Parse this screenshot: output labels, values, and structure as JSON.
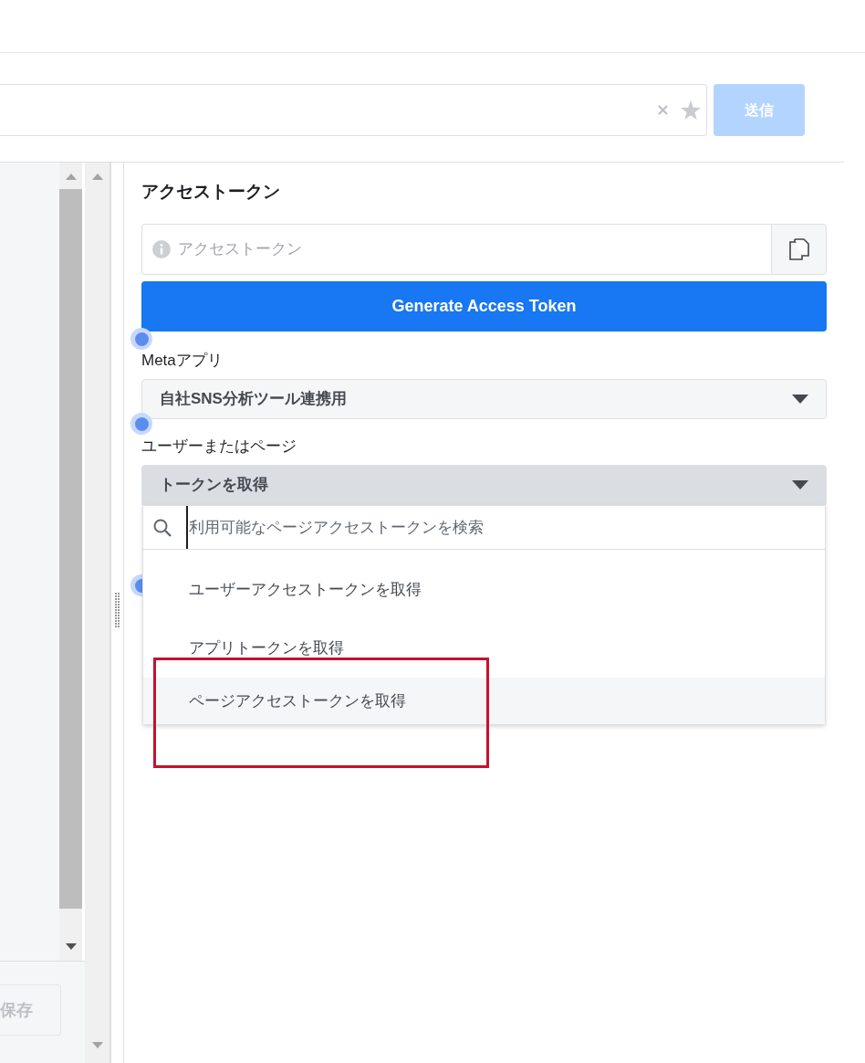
{
  "query_bar": {
    "submit_button": "送信",
    "submit_disabled": true
  },
  "left_panel": {
    "save_button": "保存"
  },
  "access_token": {
    "title": "アクセストークン",
    "field": {
      "placeholder": "アクセストークン"
    },
    "generate_button": "Generate Access Token"
  },
  "meta_app": {
    "label": "Metaアプリ",
    "value": "自社SNS分析ツール連携用"
  },
  "user_or_page": {
    "label": "ユーザーまたはページ",
    "value": "トークンを取得",
    "expanded": true,
    "search": {
      "placeholder": "利用可能なページアクセストークンを検索"
    },
    "options": [
      {
        "label": "ユーザーアクセストークンを取得",
        "selected": false
      },
      {
        "label": "アプリトークンを取得",
        "selected": false
      },
      {
        "label": "ページアクセストークンを取得",
        "selected": true
      }
    ]
  }
}
